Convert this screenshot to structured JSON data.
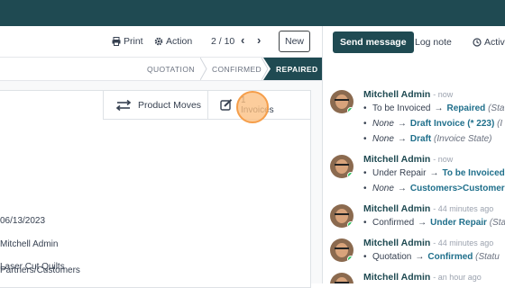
{
  "control_panel": {
    "print_label": "Print",
    "action_label": "Action",
    "pager": "2 / 10",
    "new_label": "New"
  },
  "statusbar": {
    "stages": [
      "QUOTATION",
      "CONFIRMED",
      "REPAIRED"
    ],
    "active": "REPAIRED"
  },
  "smart_buttons": {
    "product_moves": "Product Moves",
    "invoices_count": "1",
    "invoices_label": "Invoices"
  },
  "form_fields": {
    "date": "06/13/2023",
    "responsible": "Mitchell Admin",
    "category": "Partners/Customers",
    "product": "Laser Cut Quilts"
  },
  "chatter": {
    "send_message": "Send message",
    "log_note": "Log note",
    "activities": "Activi",
    "messages": [
      {
        "author": "Mitchell Admin",
        "time": "- now",
        "changes": [
          {
            "old": "To be Invoiced",
            "old_italic": false,
            "new": "Repaired",
            "field": "(Sta"
          },
          {
            "old": "None",
            "old_italic": true,
            "new": "Draft Invoice (* 223)",
            "field": "(I"
          },
          {
            "old": "None",
            "old_italic": true,
            "new": "Draft",
            "field": "(Invoice State)"
          }
        ]
      },
      {
        "author": "Mitchell Admin",
        "time": "- now",
        "changes": [
          {
            "old": "Under Repair",
            "old_italic": false,
            "new": "To be Invoiced",
            "field": ""
          },
          {
            "old": "None",
            "old_italic": true,
            "new": "Customers>Customers",
            "field": ""
          }
        ]
      },
      {
        "author": "Mitchell Admin",
        "time": "- 44 minutes ago",
        "changes": [
          {
            "old": "Confirmed",
            "old_italic": false,
            "new": "Under Repair",
            "field": "(Sta"
          }
        ]
      },
      {
        "author": "Mitchell Admin",
        "time": "- 44 minutes ago",
        "changes": [
          {
            "old": "Quotation",
            "old_italic": false,
            "new": "Confirmed",
            "field": "(Statu"
          }
        ]
      },
      {
        "author": "Mitchell Admin",
        "time": "- an hour ago",
        "changes": []
      }
    ]
  },
  "colors": {
    "brand": "#1f4a52",
    "link": "#1f6f8b",
    "highlight": "#f59e4a"
  }
}
